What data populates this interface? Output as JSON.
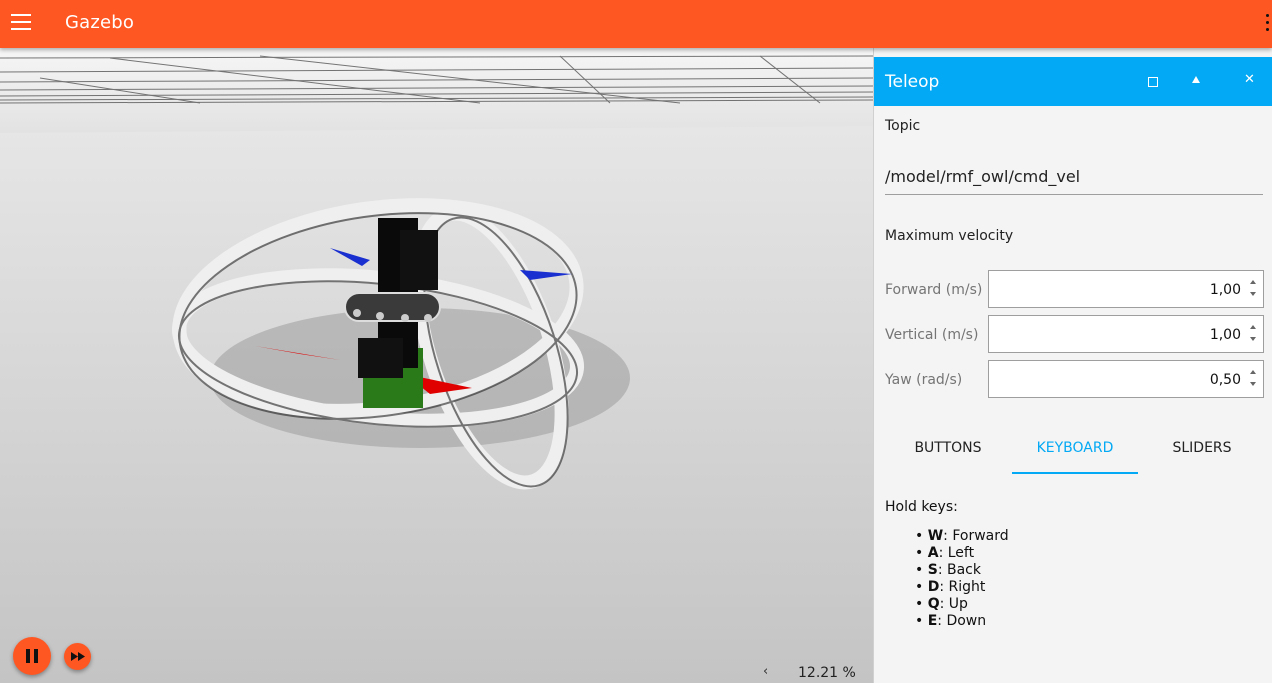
{
  "app": {
    "title": "Gazebo"
  },
  "viewport": {
    "rtf_value": "12.21 %",
    "rtf_chevron": "‹",
    "icons": [
      "pause-icon",
      "fast-forward-icon"
    ]
  },
  "panel": {
    "title": "Teleop",
    "close_glyph": "✕",
    "topic_label": "Topic",
    "topic_value": "/model/rmf_owl/cmd_vel",
    "max_velocity_label": "Maximum velocity",
    "fields": [
      {
        "label": "Forward (m/s)",
        "value": "1,00"
      },
      {
        "label": "Vertical (m/s)",
        "value": "1,00"
      },
      {
        "label": "Yaw (rad/s)",
        "value": "0,50"
      }
    ],
    "tabs": [
      "BUTTONS",
      "KEYBOARD",
      "SLIDERS"
    ],
    "active_tab": "KEYBOARD",
    "hold_keys_label": "Hold keys:",
    "keys": [
      {
        "key": "W",
        "action": ": Forward"
      },
      {
        "key": "A",
        "action": ": Left"
      },
      {
        "key": "S",
        "action": ": Back"
      },
      {
        "key": "D",
        "action": ": Right"
      },
      {
        "key": "Q",
        "action": ": Up"
      },
      {
        "key": "E",
        "action": ": Down"
      }
    ]
  },
  "colors": {
    "toolbar": "#ff5722",
    "panel_header": "#03a9f4",
    "accent": "#03a9f4",
    "control_buttons": "#ff5722"
  }
}
